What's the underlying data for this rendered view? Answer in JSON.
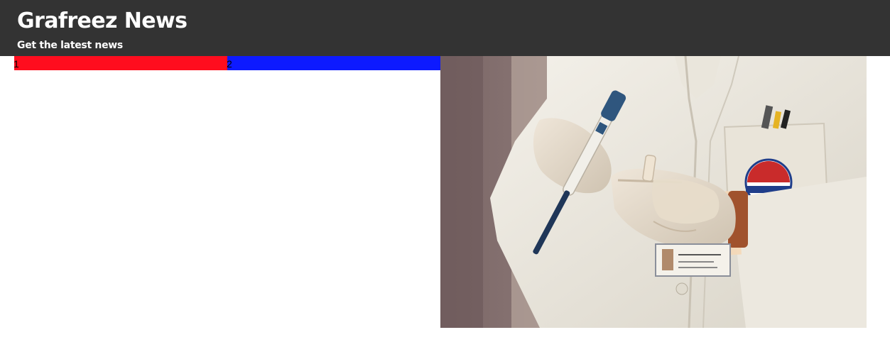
{
  "header": {
    "title": "Grafreez News",
    "tagline": "Get the latest news"
  },
  "slider": {
    "slides": [
      {
        "label": "1",
        "color": "#ff0d1e"
      },
      {
        "label": "2",
        "color": "#0d1aff"
      }
    ]
  },
  "featured_image": {
    "subject": "lab-worker-holding-pipette-photo"
  },
  "colors": {
    "header_bg": "#333333",
    "header_text": "#ffffff",
    "page_bg": "#ffffff"
  }
}
